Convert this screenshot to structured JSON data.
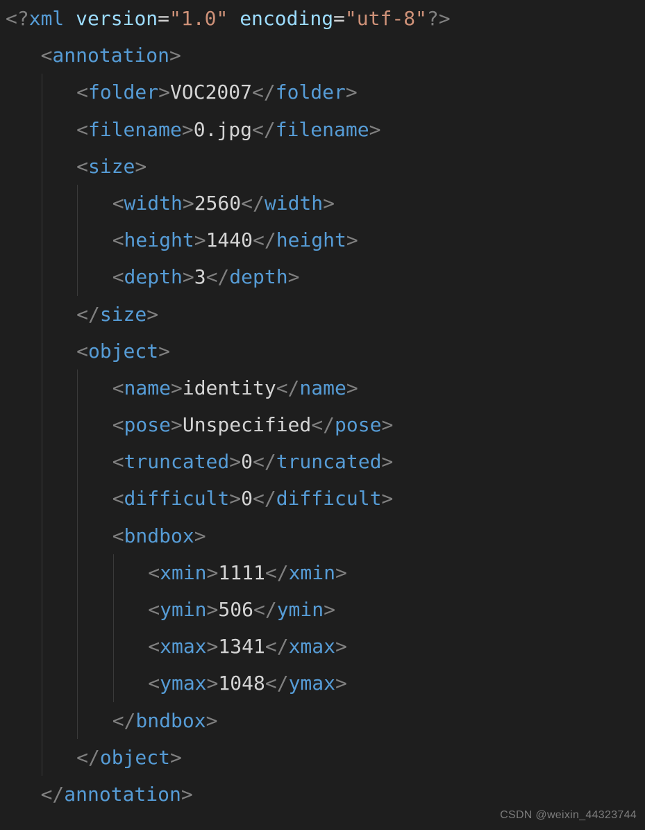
{
  "watermark": "CSDN @weixin_44323744",
  "xmlDecl": {
    "name": "xml",
    "attrs": [
      {
        "k": "version",
        "v": "\"1.0\""
      },
      {
        "k": "encoding",
        "v": "\"utf-8\""
      }
    ]
  },
  "tags": {
    "annotation": "annotation",
    "folder": "folder",
    "filename": "filename",
    "size": "size",
    "width": "width",
    "height": "height",
    "depth": "depth",
    "object": "object",
    "name": "name",
    "pose": "pose",
    "truncated": "truncated",
    "difficult": "difficult",
    "bndbox": "bndbox",
    "xmin": "xmin",
    "ymin": "ymin",
    "xmax": "xmax",
    "ymax": "ymax"
  },
  "text": {
    "folder": "VOC2007",
    "filename": "0.jpg",
    "width": "2560",
    "height": "1440",
    "depth": "3",
    "name": "identity",
    "pose": "Unspecified",
    "truncated": "0",
    "difficult": "0",
    "xmin": "1111",
    "ymin": "506",
    "xmax": "1341",
    "ymax": "1048"
  }
}
